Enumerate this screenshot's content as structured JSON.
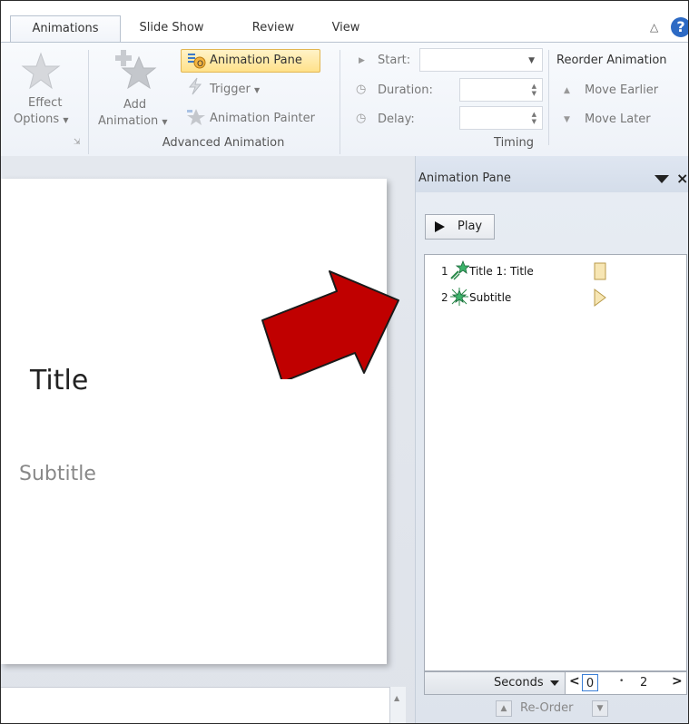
{
  "tabs": [
    "Animations",
    "Slide Show",
    "Review",
    "View"
  ],
  "help_glyph": "?",
  "ribbon": {
    "effect_options": {
      "line1": "Effect",
      "line2": "Options"
    },
    "add_animation": {
      "line1": "Add",
      "line2": "Animation"
    },
    "animation_pane_label": "Animation Pane",
    "trigger_label": "Trigger",
    "animation_painter_label": "Animation Painter",
    "advanced_group_label": "Advanced Animation",
    "start_label": "Start:",
    "duration_label": "Duration:",
    "delay_label": "Delay:",
    "timing_group_label": "Timing",
    "reorder_title": "Reorder Animation",
    "move_earlier": "Move Earlier",
    "move_later": "Move Later"
  },
  "slide": {
    "title": "Title",
    "subtitle": "Subtitle"
  },
  "pane": {
    "title": "Animation Pane",
    "play_label": "Play",
    "items": [
      {
        "num": "1",
        "label": "Title 1: Title"
      },
      {
        "num": "2",
        "label": "Subtitle"
      }
    ],
    "timeline": {
      "seconds_label": "Seconds",
      "start": "0",
      "end": "2"
    },
    "reorder_label": "Re-Order"
  },
  "colors": {
    "accent_red": "#c00000",
    "highlight": "#ffe18a",
    "help_blue": "#2d6ac4"
  }
}
